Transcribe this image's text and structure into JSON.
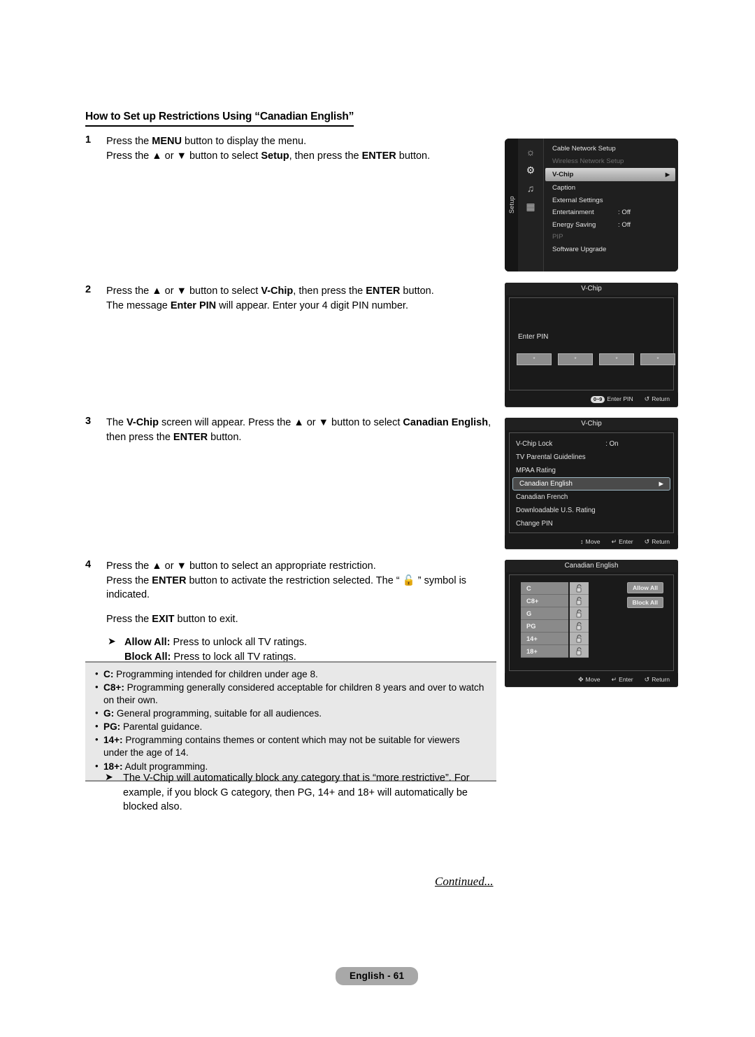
{
  "document": {
    "heading": "How to Set up Restrictions Using “Canadian English”",
    "continued": "Continued...",
    "page_badge": "English - 61"
  },
  "steps": [
    {
      "num": "1",
      "line1_a": "Press the ",
      "line1_b": "MENU",
      "line1_c": " button to display the menu.",
      "line2_a": "Press the ▲ or ▼ button to select ",
      "line2_b": "Setup",
      "line2_c": ", then press the ",
      "line2_d": "ENTER",
      "line2_e": " button."
    },
    {
      "num": "2",
      "line1_a": "Press the ▲ or ▼ button to select ",
      "line1_b": "V-Chip",
      "line1_c": ", then press the ",
      "line1_d": "ENTER",
      "line1_e": " button.",
      "line2_a": "The message ",
      "line2_b": "Enter PIN",
      "line2_c": " will appear. Enter your 4 digit PIN number."
    },
    {
      "num": "3",
      "line1_a": "The ",
      "line1_b": "V-Chip",
      "line1_c": " screen will appear. Press the ▲ or ▼ button to select ",
      "line1_d": "Canadian English",
      "line1_e": ", then press the ",
      "line1_f": "ENTER",
      "line1_g": " button."
    },
    {
      "num": "4",
      "line1": "Press the ▲ or ▼ button to select an appropriate restriction.",
      "line2_a": "Press the ",
      "line2_b": "ENTER",
      "line2_c": " button to activate the restriction selected. The “ 🔓 ” symbol is indicated.",
      "line3_a": "Press the ",
      "line3_b": "EXIT",
      "line3_c": " button to exit.",
      "bullet_allow_label": "Allow All:",
      "bullet_allow_text": " Press to unlock all TV ratings.",
      "bullet_block_label": "Block All:",
      "bullet_block_text": " Press to lock all TV ratings."
    }
  ],
  "info_box": {
    "items": [
      {
        "label": "C:",
        "text": " Programming intended for children under age 8."
      },
      {
        "label": "C8+:",
        "text": " Programming generally considered acceptable for children 8 years and over to watch on their own."
      },
      {
        "label": "G:",
        "text": " General programming, suitable for all audiences."
      },
      {
        "label": "PG:",
        "text": " Parental guidance."
      },
      {
        "label": "14+:",
        "text": " Programming contains themes or content which may not be suitable for viewers under the age of 14."
      },
      {
        "label": "18+:",
        "text": " Adult programming."
      }
    ]
  },
  "note_bottom": {
    "text": "The V-Chip will automatically block any category that is “more restrictive”. For example, if you block G category, then PG, 14+ and 18+ will automatically be blocked also.",
    "arrow": "➤"
  },
  "osd_setup": {
    "rail_label": "Setup",
    "icons": [
      "picture-icon",
      "setup-gear-icon",
      "sound-icon",
      "input-icon"
    ],
    "rows": [
      {
        "label": "Cable Network Setup",
        "value": "",
        "state": "normal"
      },
      {
        "label": "Wireless Network Setup",
        "value": "",
        "state": "dim"
      },
      {
        "label": "V-Chip",
        "value": "",
        "state": "highlight",
        "caret": "▶"
      },
      {
        "label": "Caption",
        "value": "",
        "state": "normal"
      },
      {
        "label": "External Settings",
        "value": "",
        "state": "normal"
      },
      {
        "label": "Entertainment",
        "value": ": Off",
        "state": "normal"
      },
      {
        "label": "Energy Saving",
        "value": ": Off",
        "state": "normal"
      },
      {
        "label": "PIP",
        "value": "",
        "state": "dim"
      },
      {
        "label": "Software Upgrade",
        "value": "",
        "state": "normal"
      }
    ]
  },
  "osd_pin": {
    "title": "V-Chip",
    "label": "Enter PIN",
    "digits": [
      "*",
      "*",
      "*",
      "*"
    ],
    "footer": {
      "key_pill": "0~9",
      "key_action": "Enter PIN",
      "return_glyph": "↺",
      "return_label": "Return"
    }
  },
  "osd_vchip": {
    "title": "V-Chip",
    "rows": [
      {
        "label": "V-Chip Lock",
        "value": ": On",
        "state": "normal"
      },
      {
        "label": "TV Parental Guidelines",
        "value": "",
        "state": "normal"
      },
      {
        "label": "MPAA Rating",
        "value": "",
        "state": "normal"
      },
      {
        "label": "Canadian English",
        "value": "",
        "state": "selected",
        "caret": "▶"
      },
      {
        "label": "Canadian French",
        "value": "",
        "state": "normal"
      },
      {
        "label": "Downloadable U.S. Rating",
        "value": "",
        "state": "normal"
      },
      {
        "label": "Change PIN",
        "value": "",
        "state": "normal"
      }
    ],
    "footer": {
      "move_glyph": "↕",
      "move_label": "Move",
      "enter_glyph": "↵",
      "enter_label": "Enter",
      "return_glyph": "↺",
      "return_label": "Return"
    }
  },
  "osd_canadian_english": {
    "title": "Canadian English",
    "ratings": [
      "C",
      "C8+",
      "G",
      "PG",
      "14+",
      "18+"
    ],
    "lock_state": "unlocked",
    "allow_all": "Allow All",
    "block_all": "Block All",
    "footer": {
      "move_glyph": "✥",
      "move_label": "Move",
      "enter_glyph": "↵",
      "enter_label": "Enter",
      "return_glyph": "↺",
      "return_label": "Return"
    }
  },
  "colors": {
    "osd_bg": "#1a1a1a",
    "highlight": "#c4c4c4",
    "info_box_bg": "#e8e8e8",
    "page_badge_bg": "#a8a8a8"
  }
}
